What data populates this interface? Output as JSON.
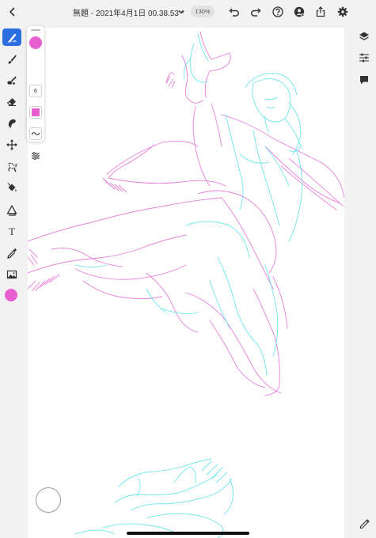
{
  "app": {
    "document_title": "無題 - 2021年4月1日 00.38.53 *",
    "zoom_level": "130%"
  },
  "colors": {
    "accent": "#2d6fe0",
    "brush_color": "#e85fd0",
    "sketch_cyan": "#57e1e6",
    "sketch_pink": "#e36ad6",
    "background": "#f2f2f2",
    "canvas": "#ffffff"
  },
  "topbar": {
    "back_icon": "chevron-left-icon",
    "title_dropdown_icon": "chevron-down-icon",
    "undo_icon": "undo-icon",
    "redo_icon": "redo-icon",
    "help_icon": "help-icon",
    "account_icon": "user-add-icon",
    "share_icon": "share-icon",
    "settings_icon": "gear-icon",
    "fullscreen_icon": "expand-icon"
  },
  "left_toolbar": {
    "tools": [
      {
        "name": "pixel-brush",
        "icon": "pencil-brush-icon",
        "active": true
      },
      {
        "name": "vector-brush",
        "icon": "brush-icon",
        "active": false
      },
      {
        "name": "mixer-brush",
        "icon": "mixer-brush-icon",
        "active": false
      },
      {
        "name": "eraser",
        "icon": "eraser-icon",
        "active": false
      },
      {
        "name": "smudge",
        "icon": "smudge-icon",
        "active": false
      },
      {
        "name": "move",
        "icon": "move-icon",
        "active": false
      },
      {
        "name": "lasso",
        "icon": "lasso-icon",
        "active": false
      },
      {
        "name": "fill",
        "icon": "paint-bucket-icon",
        "active": false
      },
      {
        "name": "shapes",
        "icon": "shapes-icon",
        "active": false
      },
      {
        "name": "text",
        "icon": "text-icon",
        "active": false
      },
      {
        "name": "eyedropper",
        "icon": "eyedropper-icon",
        "active": false
      },
      {
        "name": "image",
        "icon": "image-icon",
        "active": false
      }
    ],
    "text_tool_glyph": "T"
  },
  "brush_panel": {
    "size_value": "6",
    "stroke_icon": "stroke-wave-icon",
    "settings_icon": "brush-settings-icon"
  },
  "right_toolbar": {
    "layers_icon": "layers-icon",
    "properties_icon": "sliders-icon",
    "comments_icon": "comment-icon",
    "edit_icon": "pencil-icon"
  }
}
